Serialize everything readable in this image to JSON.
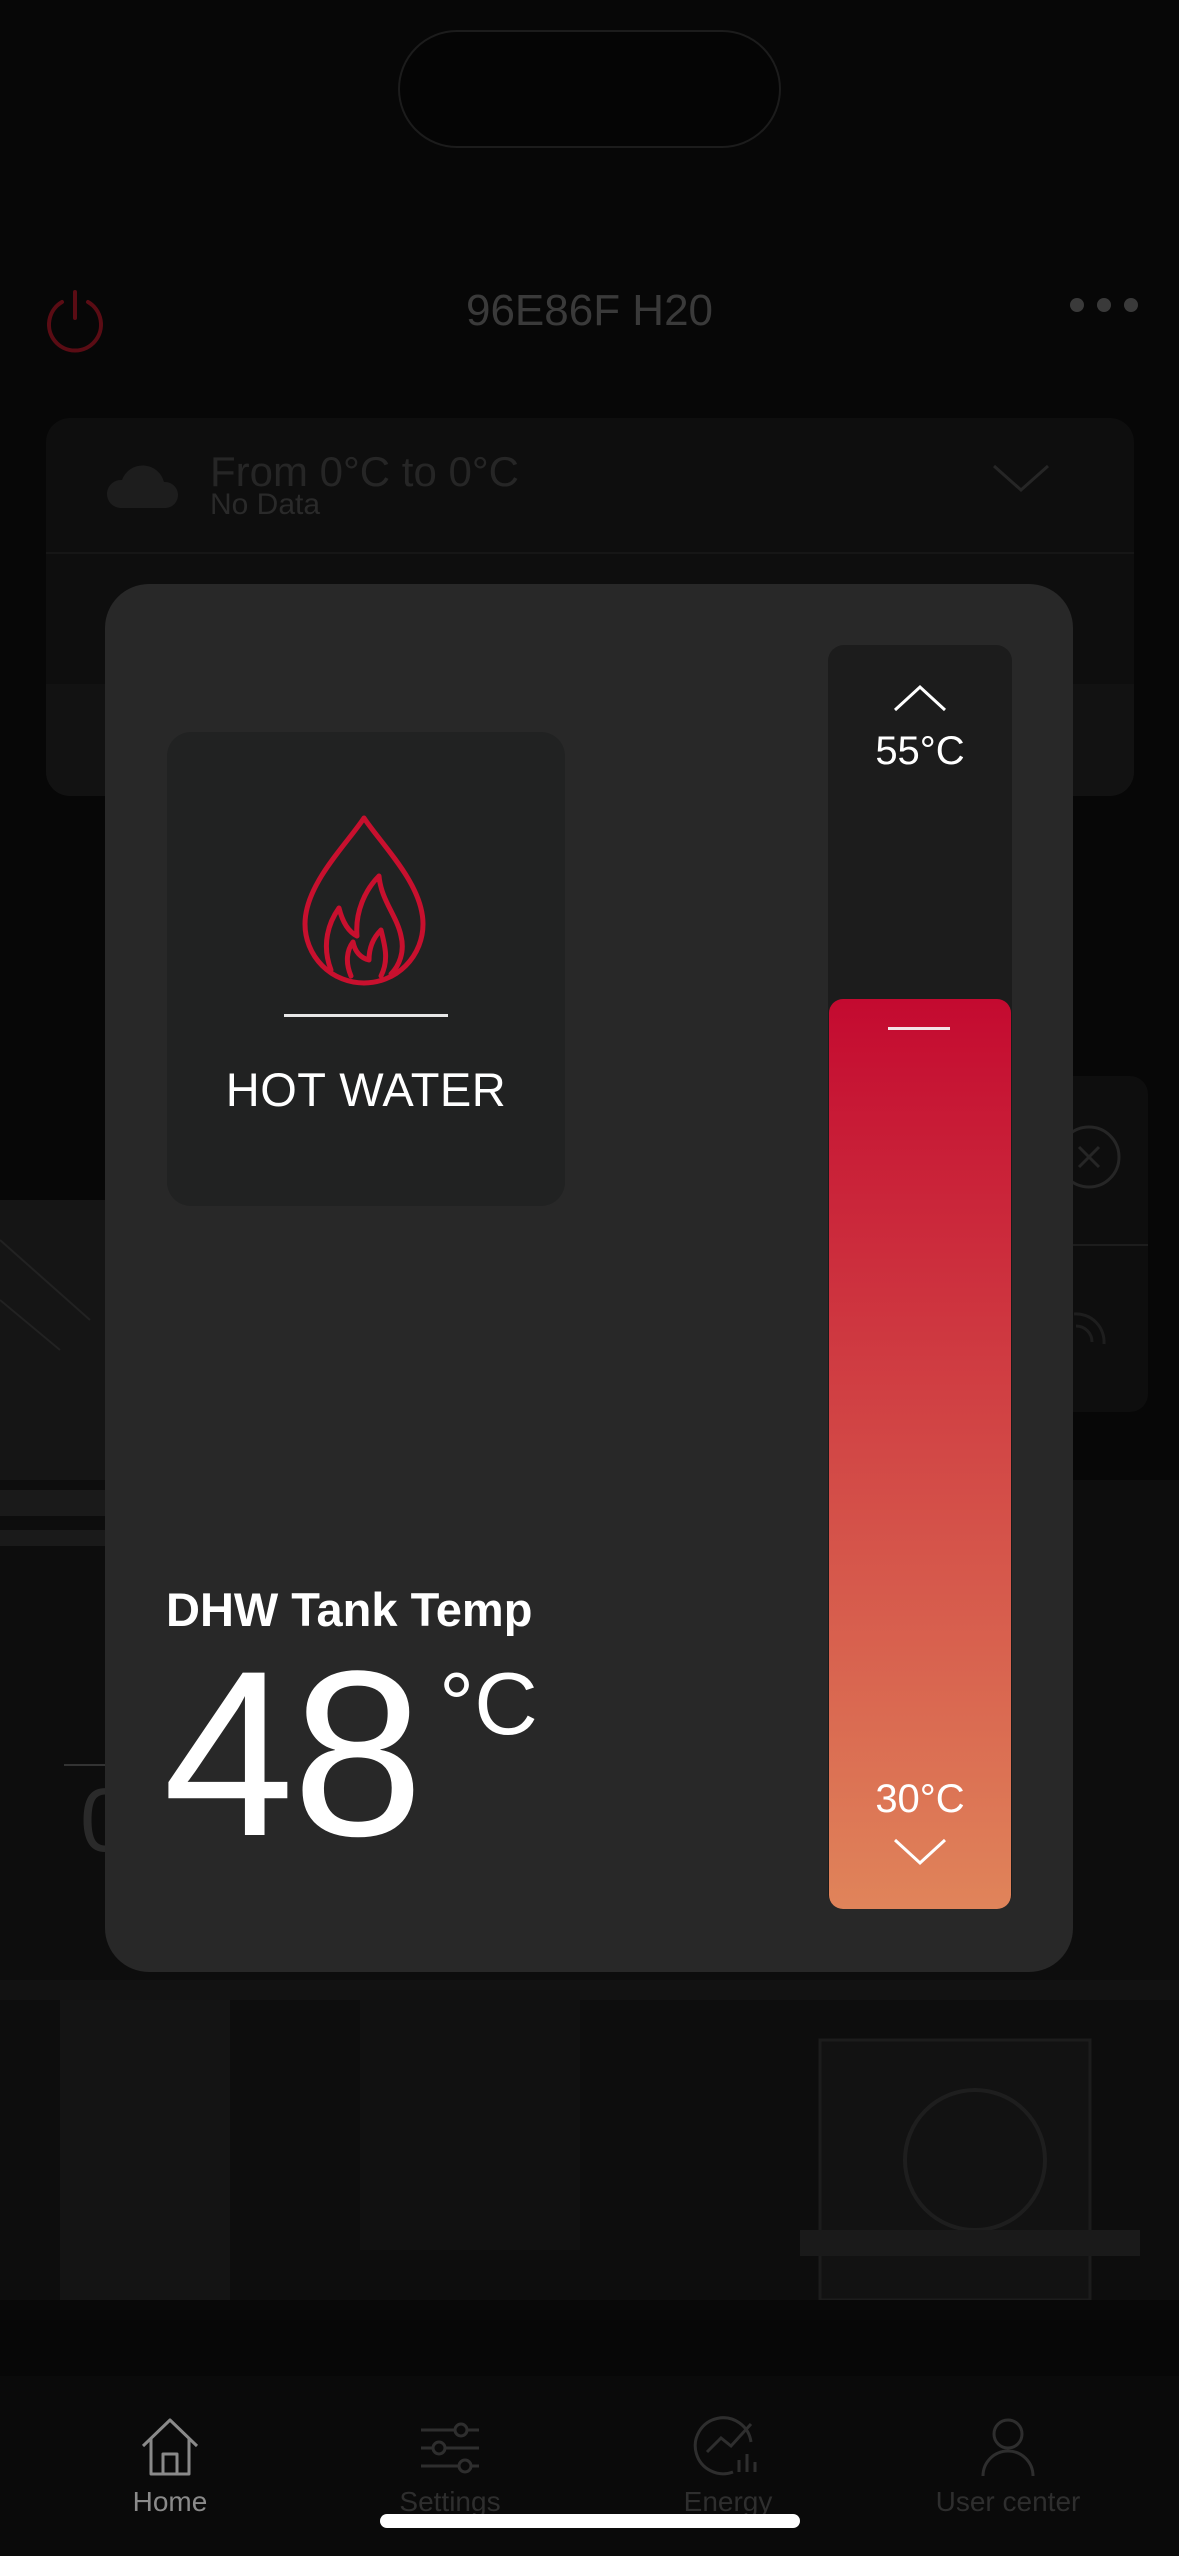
{
  "header": {
    "device_name": "96E86F H20"
  },
  "status_card": {
    "range_text": "From 0°C to 0°C",
    "no_data_text": "No Data"
  },
  "background": {
    "partial_number": "0"
  },
  "tabbar": {
    "tabs": [
      {
        "label": "Home",
        "icon": "home-icon",
        "active": true
      },
      {
        "label": "Settings",
        "icon": "sliders-icon",
        "active": false
      },
      {
        "label": "Energy",
        "icon": "energy-chart-icon",
        "active": false
      },
      {
        "label": "User center",
        "icon": "user-icon",
        "active": false
      }
    ]
  },
  "modal": {
    "mode": {
      "label": "HOT WATER",
      "icon": "flame-drop-icon",
      "color": "#c8102e"
    },
    "current_temp": {
      "caption": "DHW Tank Temp",
      "value": "48",
      "unit": "°C"
    },
    "setpoint_slider": {
      "max_label": "55°C",
      "min_label": "30°C",
      "level_fraction": 0.72,
      "gradient_colors": [
        "#c40a30",
        "#e0845a"
      ]
    }
  },
  "colors": {
    "accent": "#c8102e",
    "modal_bg": "#282828",
    "page_bg": "#000000"
  }
}
